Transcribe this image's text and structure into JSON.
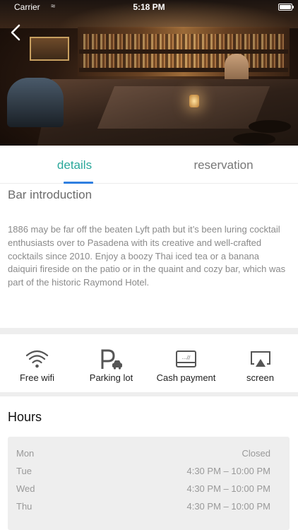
{
  "status_bar": {
    "carrier": "Carrier",
    "time": "5:18 PM"
  },
  "tabs": [
    {
      "label": "details",
      "active": true
    },
    {
      "label": "reservation",
      "active": false
    }
  ],
  "intro": {
    "title": "Bar introduction",
    "text": "1886 may be far off the beaten Lyft path but it’s been luring cocktail enthusiasts over to Pasadena with its creative and well-crafted cocktails since 2010. Enjoy a boozy Thai iced tea or a banana daiquiri fireside on the patio or in the quaint and cozy bar, which was part of the historic Raymond Hotel."
  },
  "amenities": [
    {
      "label": "Free wifi",
      "icon": "wifi-icon"
    },
    {
      "label": "Parking lot",
      "icon": "parking-icon"
    },
    {
      "label": "Cash payment",
      "icon": "card-icon"
    },
    {
      "label": "screen",
      "icon": "screen-icon"
    }
  ],
  "hours": {
    "title": "Hours",
    "rows": [
      {
        "day": "Mon",
        "time": "Closed"
      },
      {
        "day": "Tue",
        "time": "4:30 PM – 10:00 PM"
      },
      {
        "day": "Wed",
        "time": "4:30 PM – 10:00 PM"
      },
      {
        "day": "Thu",
        "time": "4:30 PM – 10:00 PM"
      }
    ]
  },
  "colors": {
    "accent": "#2aa79a",
    "underline": "#2f7fe0",
    "muted": "#8a8a8a"
  }
}
